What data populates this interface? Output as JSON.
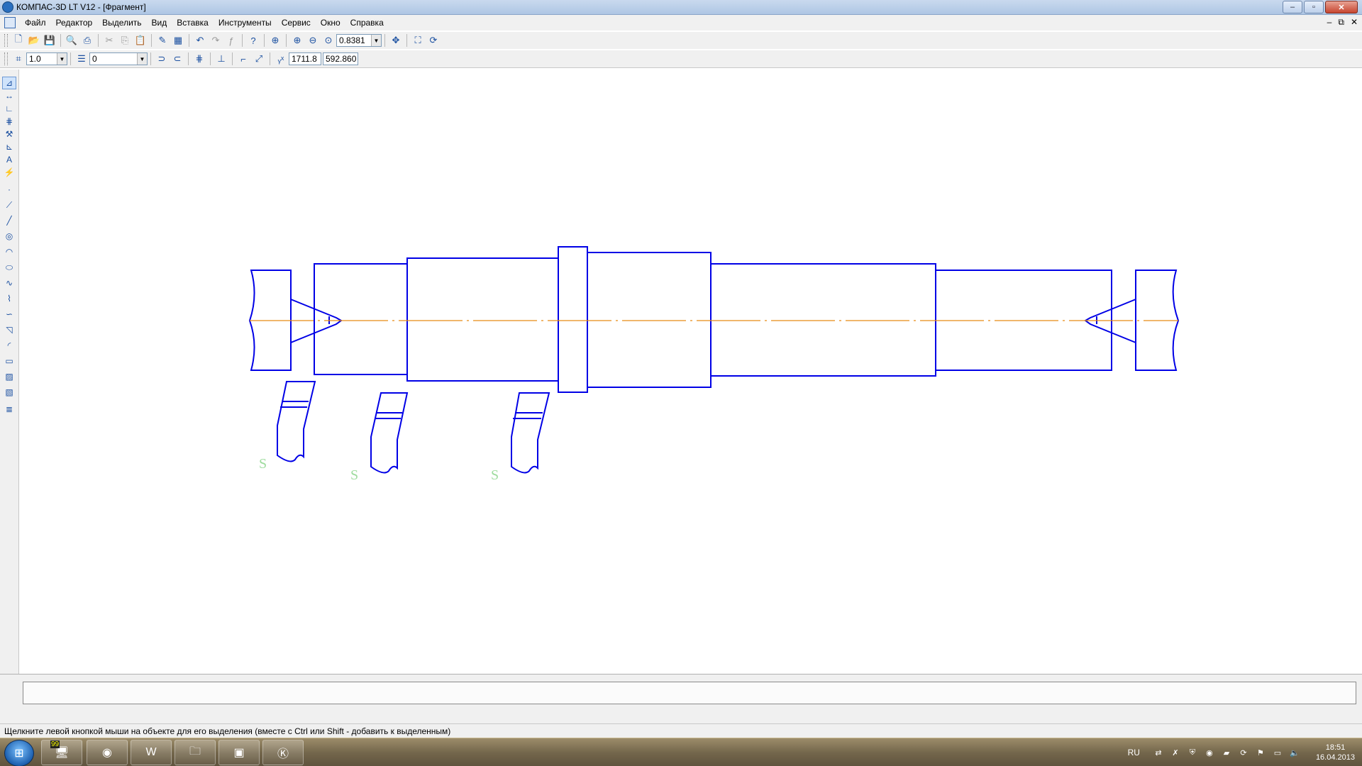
{
  "window": {
    "title": "КОМПАС-3D LT V12 - [Фрагмент]",
    "minimize": "–",
    "maximize": "▫",
    "close": "✕"
  },
  "menu": {
    "items": [
      "Файл",
      "Редактор",
      "Выделить",
      "Вид",
      "Вставка",
      "Инструменты",
      "Сервис",
      "Окно",
      "Справка"
    ],
    "doc_controls": [
      "–",
      "⧉",
      "✕"
    ]
  },
  "toolbar1": {
    "zoom_value": "0.8381"
  },
  "toolbar2": {
    "step_value": "1.0",
    "layer_value": "0",
    "coord_x": "1711.8",
    "coord_y": "592.860"
  },
  "status": {
    "hint": "Щелкните левой кнопкой мыши на объекте для его выделения (вместе с Ctrl или Shift - добавить к выделенным)"
  },
  "taskbar": {
    "lang": "RU",
    "time": "18:51",
    "date": "16.04.2013",
    "badge": "99"
  },
  "drawing": {
    "line_color": "#0000e6",
    "axis_color": "#e88a14",
    "tool_mark_color": "#9fdc9f",
    "tool_mark": "S"
  },
  "icons": {
    "app": "kompas-logo-icon",
    "start": "windows-start-icon"
  }
}
